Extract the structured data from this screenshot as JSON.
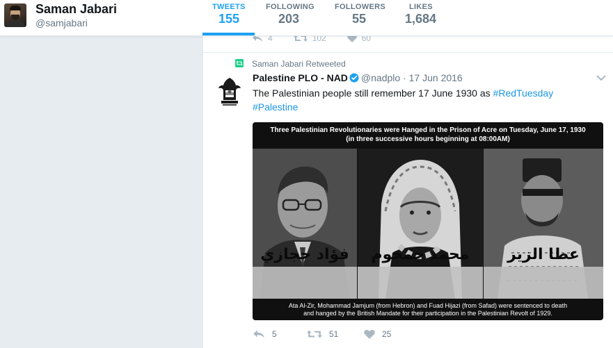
{
  "profile": {
    "name": "Saman Jabari",
    "handle": "@samjabari"
  },
  "nav": {
    "items": [
      {
        "label": "TWEETS",
        "value": "155",
        "active": true
      },
      {
        "label": "FOLLOWING",
        "value": "203",
        "active": false
      },
      {
        "label": "FOLLOWERS",
        "value": "55",
        "active": false
      },
      {
        "label": "LIKES",
        "value": "1,684",
        "active": false
      }
    ]
  },
  "previous_tweet": {
    "replies": "4",
    "retweets": "102",
    "likes": "60"
  },
  "tweet": {
    "retweeted_by": "Saman Jabari Retweeted",
    "author": "Palestine PLO - NAD",
    "handle": "@nadplo",
    "separator": "·",
    "date": "17 Jun 2016",
    "text": "The Palestinian people still remember 17 June 1930 as ",
    "hashtag1": "#RedTuesday",
    "hashtag2": "#Palestine",
    "media": {
      "title_line1": "Three Palestinian Revolutionaries were Hanged in the Prison of Acre on Tuesday, June 17, 1930",
      "title_line2": "(in three successive hours beginning at 08:00AM)",
      "name1": "فؤاد حجازي",
      "name2": "محمد جمجوم",
      "name3": "عطا الزير",
      "caption_line1": "Ata Al-Zir, Mohammad Jamjum (from Hebron) and Fuad Hijazi (from Safad) were sentenced to death",
      "caption_line2": "and hanged by the British Mandate for their participation in the Palestinian Revolt of 1929."
    },
    "replies": "5",
    "retweets": "51",
    "likes": "25"
  },
  "colors": {
    "accent": "#1da1f2",
    "link": "#1b95e0",
    "retweet_green": "#19cf86",
    "muted": "#657786"
  }
}
